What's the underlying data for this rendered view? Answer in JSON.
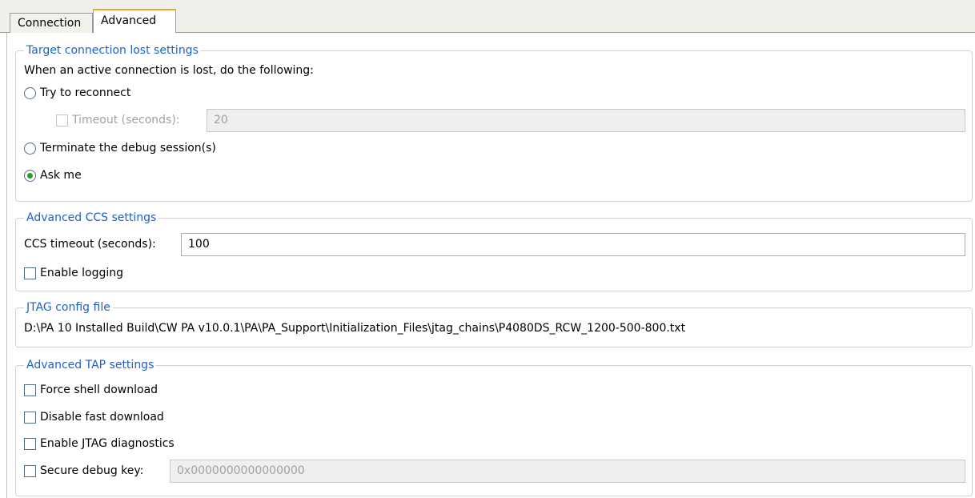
{
  "tabs": [
    {
      "label": "Connection",
      "active": false
    },
    {
      "label": "Advanced",
      "active": true
    }
  ],
  "connection_lost": {
    "title": "Target connection lost settings",
    "prompt": "When an active connection is lost, do the following:",
    "try_reconnect_label": "Try to reconnect",
    "timeout_label": "Timeout (seconds):",
    "timeout_value": "20",
    "terminate_label": "Terminate the debug session(s)",
    "ask_me_label": "Ask me",
    "selected": "Ask me"
  },
  "ccs": {
    "title": "Advanced CCS settings",
    "timeout_label": "CCS timeout (seconds):",
    "timeout_value": "100",
    "enable_logging_label": "Enable logging"
  },
  "jtag": {
    "title": "JTAG config file",
    "path": "D:\\PA 10 Installed Build\\CW PA v10.0.1\\PA\\PA_Support\\Initialization_Files\\jtag_chains\\P4080DS_RCW_1200-500-800.txt"
  },
  "tap": {
    "title": "Advanced TAP settings",
    "force_shell_label": "Force shell download",
    "disable_fast_label": "Disable fast download",
    "jtag_diag_label": "Enable JTAG diagnostics",
    "secure_key_label": "Secure debug key:",
    "secure_key_placeholder": "0x0000000000000000"
  },
  "colors": {
    "legend": "#1f5fc8",
    "active_tab_accent": "#f5a623",
    "radio_dot": "#2a9d2a"
  }
}
